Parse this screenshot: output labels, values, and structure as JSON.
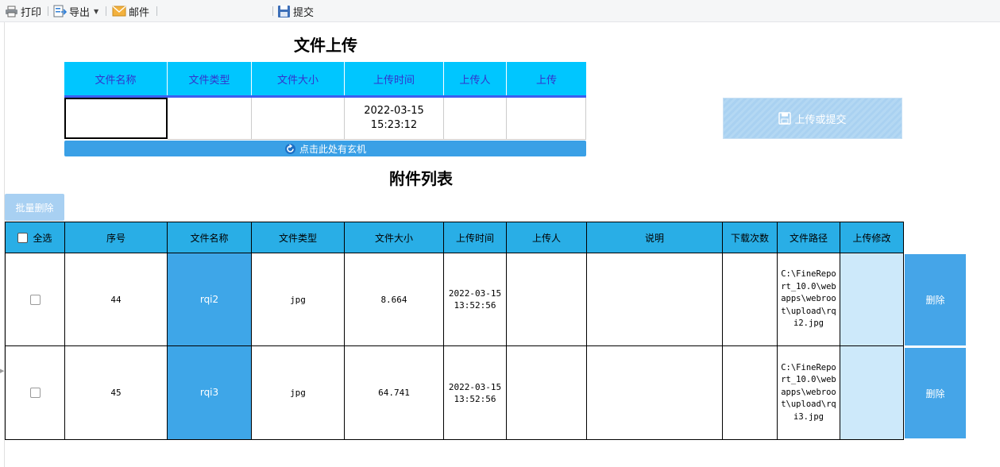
{
  "toolbar": {
    "print_label": "打印",
    "export_label": "导出",
    "mail_label": "邮件",
    "submit_label": "提交"
  },
  "upload": {
    "title": "文件上传",
    "headers": [
      "文件名称",
      "文件类型",
      "文件大小",
      "上传时间",
      "上传人",
      "上传"
    ],
    "row": {
      "name": "",
      "type": "",
      "size": "",
      "time": "2022-03-15 15:23:12",
      "uploader": "",
      "upload": ""
    },
    "refresh_label": "点击此处有玄机",
    "submit_button": "上传或提交"
  },
  "attachments": {
    "title": "附件列表",
    "batch_delete": "批量删除",
    "headers": [
      "全选",
      "序号",
      "文件名称",
      "文件类型",
      "文件大小",
      "上传时间",
      "上传人",
      "说明",
      "下载次数",
      "文件路径",
      "上传修改"
    ],
    "rows": [
      {
        "seq": "44",
        "name": "rqi2",
        "type": "jpg",
        "size": "8.664",
        "time": "2022-03-15 13:52:56",
        "uploader": "",
        "note": "",
        "downloads": "",
        "path": "C:\\FineReport_10.0\\webapps\\webroot\\upload\\rqi2.jpg",
        "delete_label": "删除"
      },
      {
        "seq": "45",
        "name": "rqi3",
        "type": "jpg",
        "size": "64.741",
        "time": "2022-03-15 13:52:56",
        "uploader": "",
        "note": "",
        "downloads": "",
        "path": "C:\\FineReport_10.0\\webapps\\webroot\\upload\\rqi3.jpg",
        "delete_label": "删除"
      }
    ]
  },
  "icons": [
    "print-icon",
    "export-icon",
    "mail-icon",
    "save-icon",
    "refresh-icon",
    "checkbox-icon"
  ],
  "colors": {
    "upload_header_bg": "#00c6ff",
    "upload_header_text": "#3333cc",
    "attachment_header_bg": "#29aee6",
    "name_cell_bg": "#3ea6e8",
    "delete_button_bg": "#45a5e8",
    "modify_cell_bg": "#cde9fa"
  }
}
